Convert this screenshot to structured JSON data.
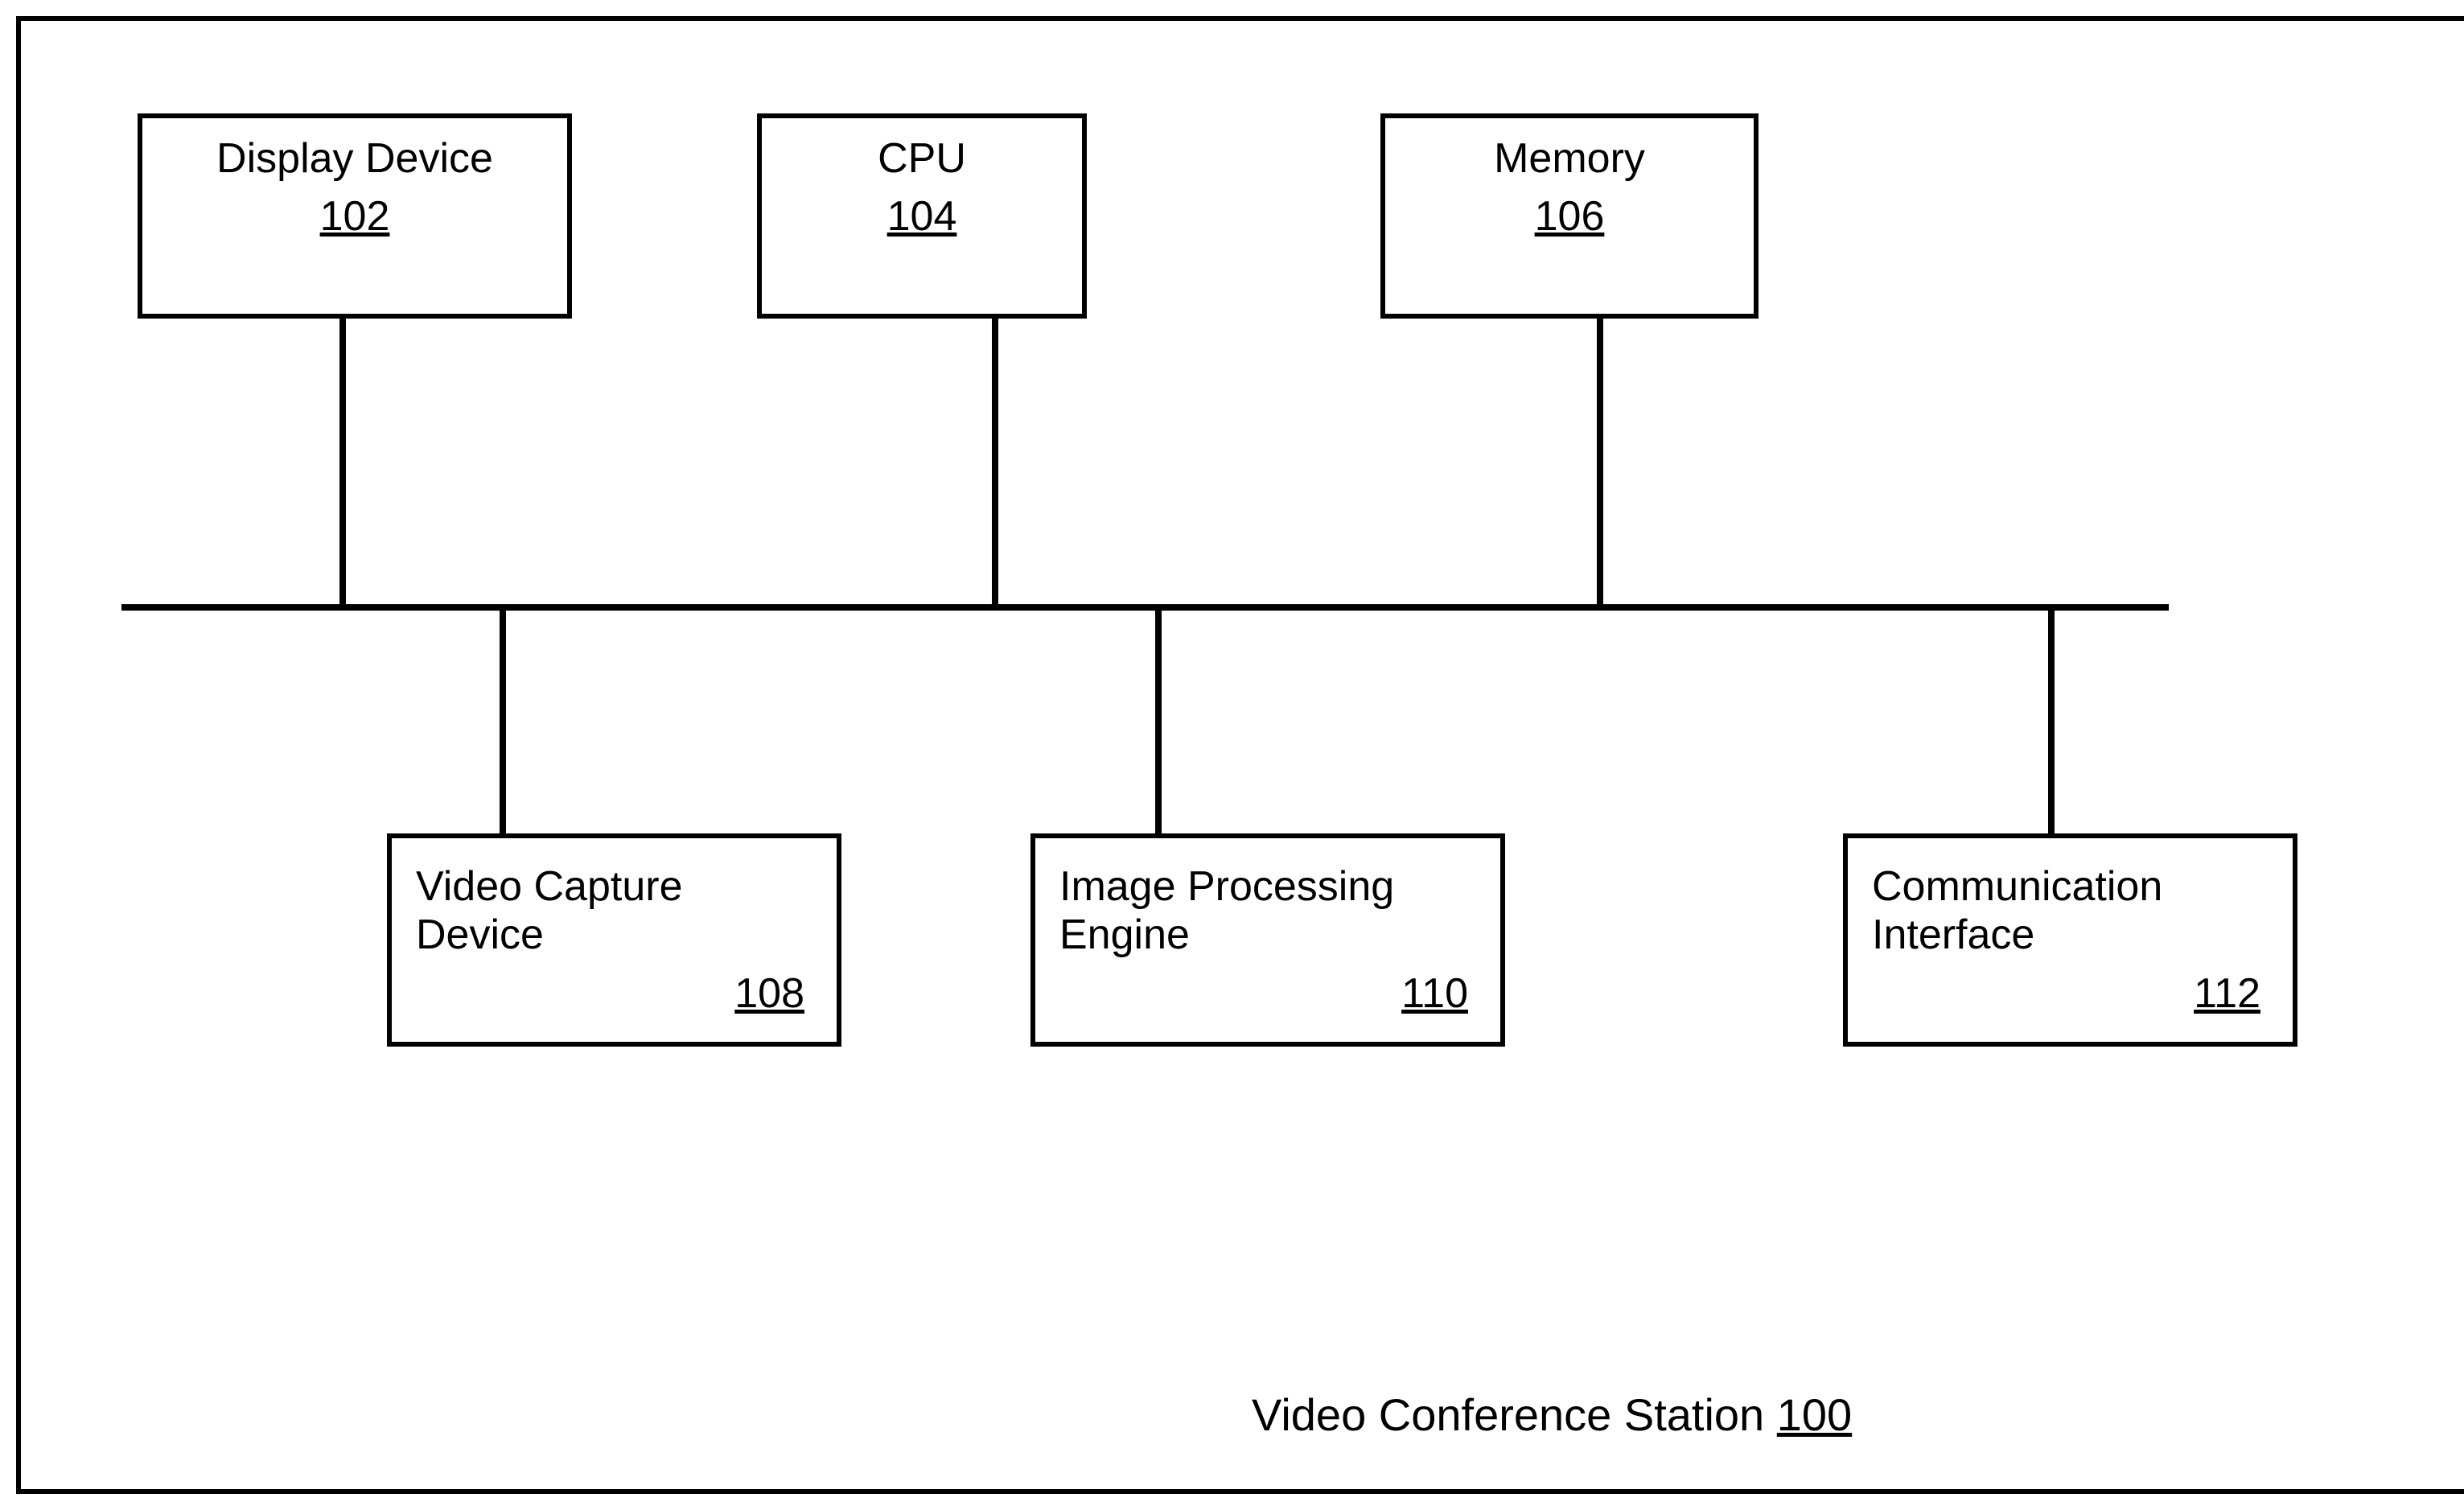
{
  "boxes": {
    "display_device": {
      "label": "Display Device",
      "ref": "102"
    },
    "cpu": {
      "label": "CPU",
      "ref": "104"
    },
    "memory": {
      "label": "Memory",
      "ref": "106"
    },
    "video_capture": {
      "label": "Video Capture Device",
      "ref": "108"
    },
    "image_processing": {
      "label": "Image Processing Engine",
      "ref": "110"
    },
    "communication": {
      "label": "Communication Interface",
      "ref": "112"
    }
  },
  "caption": {
    "label": "Video Conference Station",
    "ref": "100"
  }
}
